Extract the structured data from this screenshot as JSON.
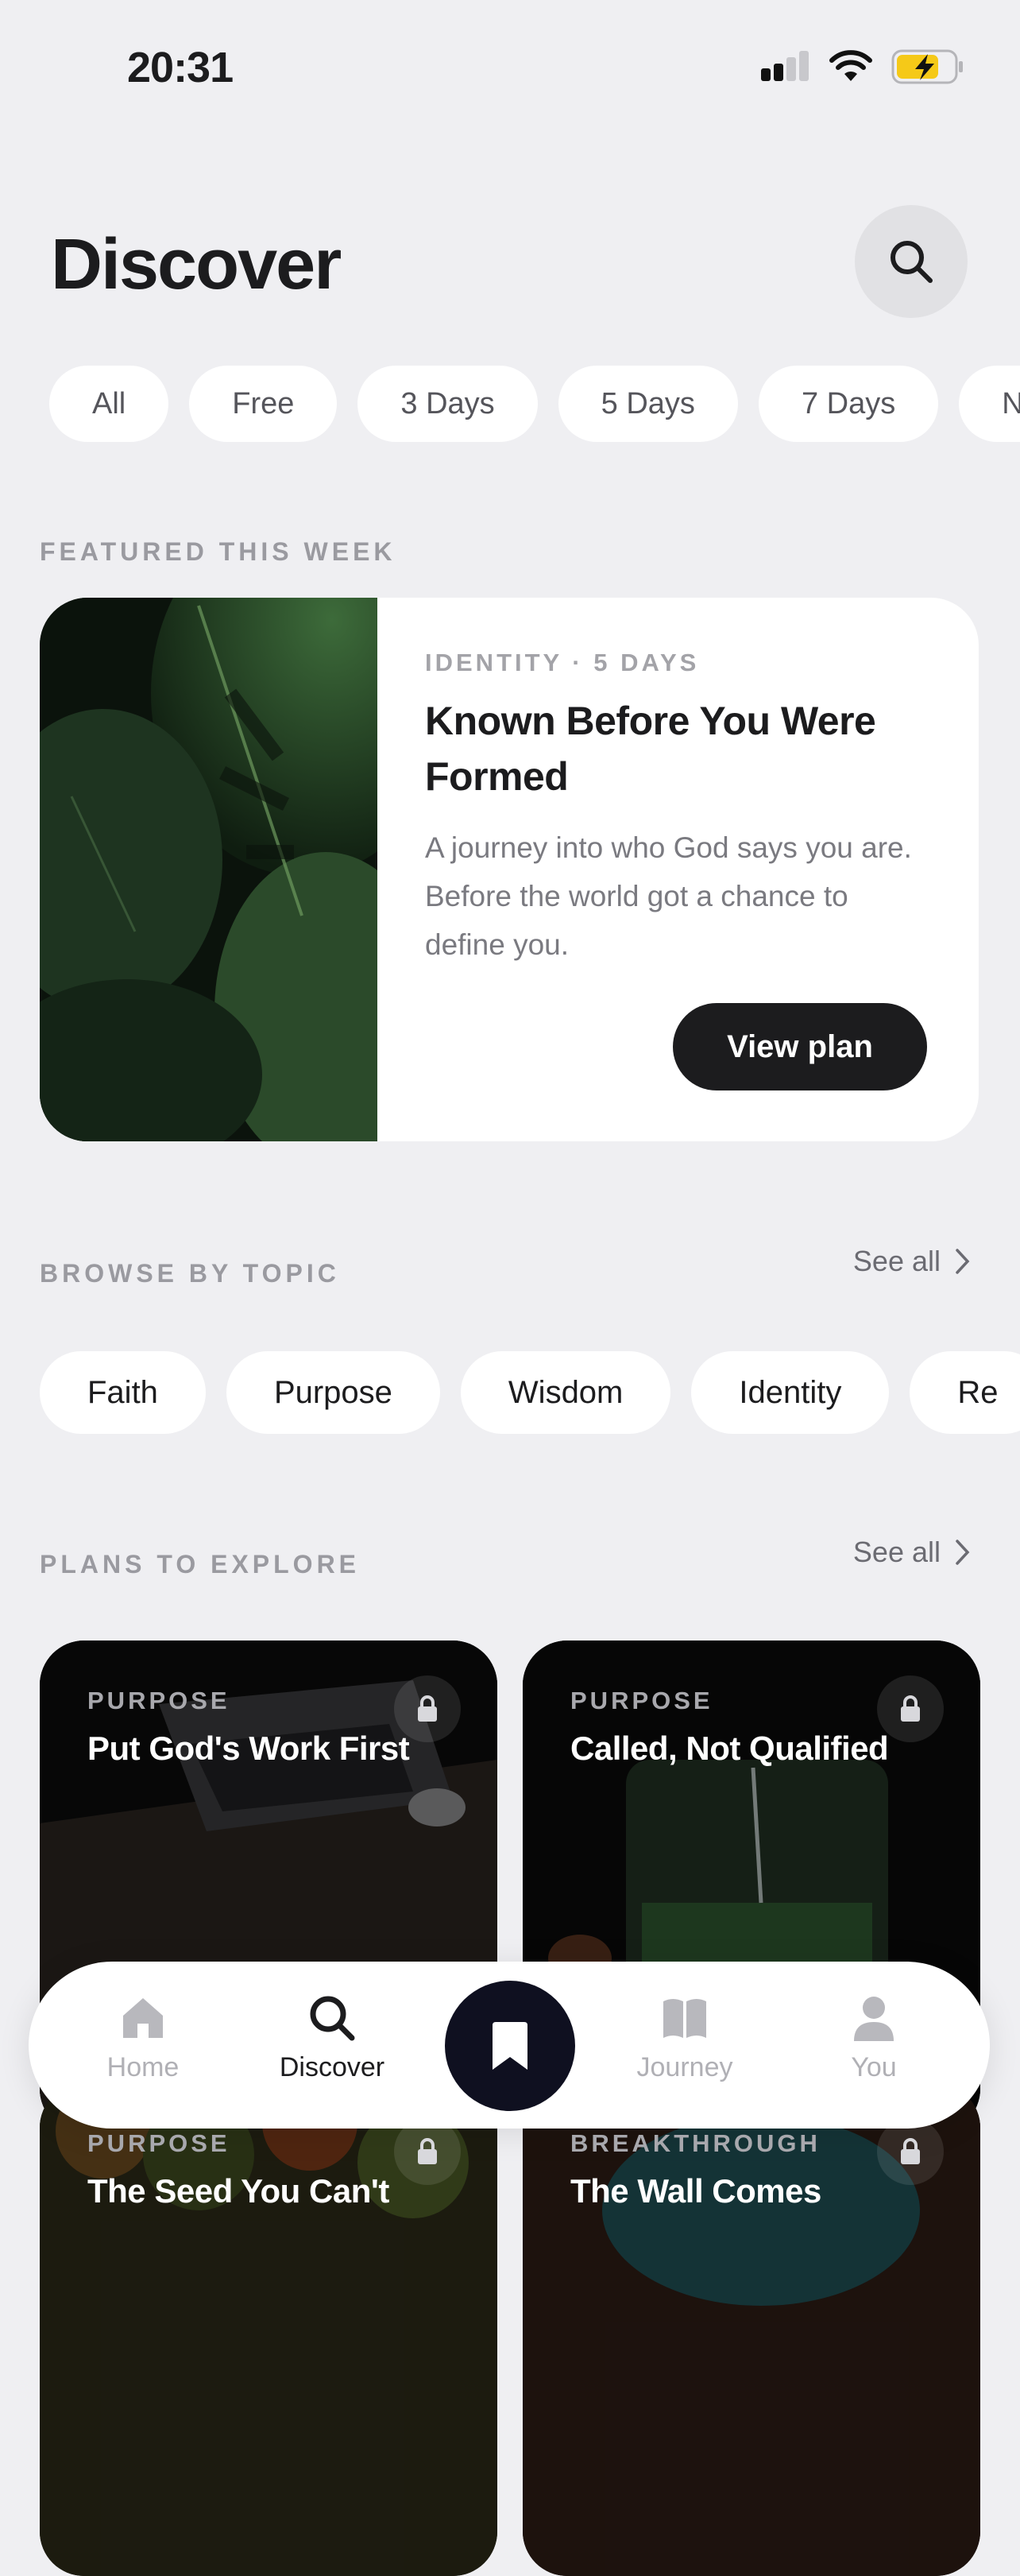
{
  "status_bar": {
    "time": "20:31"
  },
  "header": {
    "title": "Discover"
  },
  "filters": [
    "All",
    "Free",
    "3 Days",
    "5 Days",
    "7 Days",
    "N"
  ],
  "featured": {
    "section_label": "FEATURED THIS WEEK",
    "meta": "IDENTITY · 5 DAYS",
    "title": "Known Before You Were Formed",
    "description": "A journey into who God says you are. Before the world got a chance to define you.",
    "button_label": "View plan"
  },
  "topics": {
    "section_label": "BROWSE BY TOPIC",
    "see_all": "See all",
    "items": [
      "Faith",
      "Purpose",
      "Wisdom",
      "Identity",
      "Re"
    ]
  },
  "plans": {
    "section_label": "PLANS TO EXPLORE",
    "see_all": "See all",
    "items": [
      {
        "category": "PURPOSE",
        "title": "Put God's Work First"
      },
      {
        "category": "PURPOSE",
        "title": "Called, Not Qualified"
      },
      {
        "category": "PURPOSE",
        "title": "The Seed You Can't"
      },
      {
        "category": "BREAKTHROUGH",
        "title": "The Wall Comes"
      }
    ]
  },
  "tabbar": {
    "items": [
      {
        "label": "Home",
        "icon": "home-icon"
      },
      {
        "label": "Discover",
        "icon": "search-icon"
      },
      {
        "label": "",
        "icon": "bookmark-icon"
      },
      {
        "label": "Journey",
        "icon": "book-icon"
      },
      {
        "label": "You",
        "icon": "person-icon"
      }
    ]
  },
  "colors": {
    "background": "#EFEFF2",
    "accent_dark": "#1c1c1e",
    "center_button": "#0f1020"
  }
}
